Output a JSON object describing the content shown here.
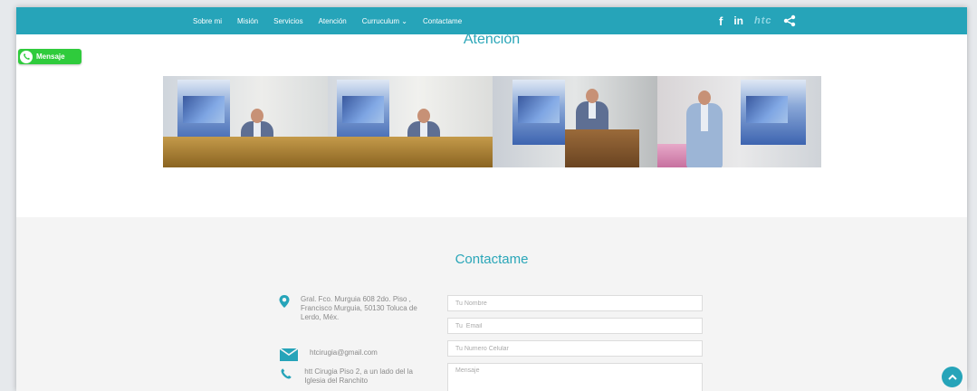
{
  "navbar": {
    "items": [
      "Sobre mi",
      "Misión",
      "Servicios",
      "Atención",
      "Curruculum ⌄",
      "Contactame"
    ],
    "social": {
      "facebook": "f",
      "linkedin": "in",
      "brand": "htc"
    }
  },
  "whatsapp": {
    "label": "Mensaje"
  },
  "atencion": {
    "title": "Atención"
  },
  "contact": {
    "title": "Contactame",
    "address": "Gral. Fco. Murguia 608 2do. Piso , Francisco Murguia, 50130 Toluca de Lerdo, Méx.",
    "email": "htcirugia@gmail.com",
    "location": "htt Cirugia Piso 2, a un lado del la Iglesia del Ranchito",
    "form": {
      "name_placeholder": "Tu Nombre",
      "email_placeholder": "Tu  Email",
      "phone_placeholder": "Tu Numero Celular",
      "message_placeholder": "Mensaje"
    }
  },
  "colors": {
    "accent": "#26a4b9",
    "whatsapp": "#2fcb3c",
    "title": "#2aa6b8"
  },
  "icons": [
    "facebook-icon",
    "linkedin-icon",
    "share-icon",
    "whatsapp-icon",
    "map-pin-icon",
    "envelope-icon",
    "phone-icon",
    "chevron-up-icon"
  ]
}
